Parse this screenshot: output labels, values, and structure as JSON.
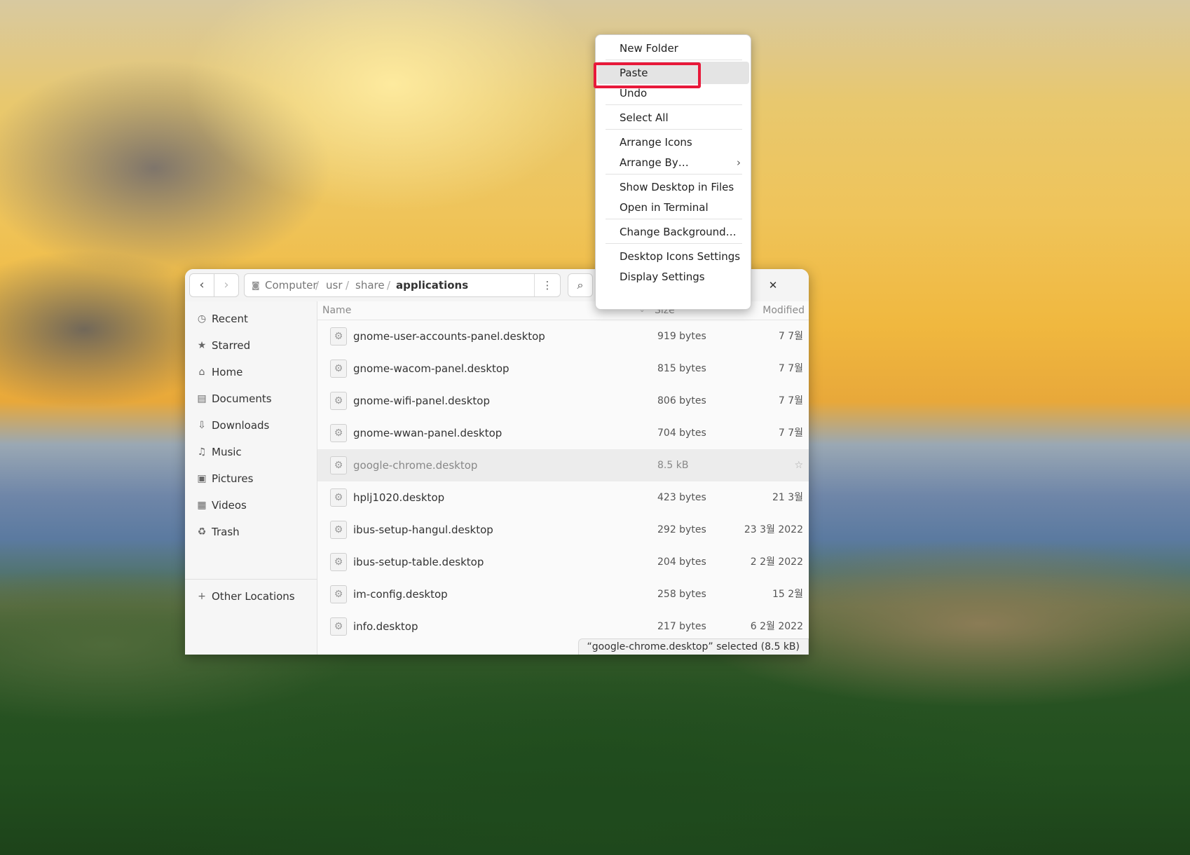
{
  "window": {
    "path": [
      "Computer",
      "usr",
      "share",
      "applications"
    ],
    "columns": {
      "name": "Name",
      "size": "Size",
      "modified": "Modified"
    },
    "sidebar": [
      {
        "label": "Recent",
        "icon": "clock-icon",
        "glyph": "◷"
      },
      {
        "label": "Starred",
        "icon": "star-icon",
        "glyph": "★"
      },
      {
        "label": "Home",
        "icon": "home-icon",
        "glyph": "⌂"
      },
      {
        "label": "Documents",
        "icon": "document-icon",
        "glyph": "▤"
      },
      {
        "label": "Downloads",
        "icon": "download-icon",
        "glyph": "⇩"
      },
      {
        "label": "Music",
        "icon": "music-icon",
        "glyph": "♫"
      },
      {
        "label": "Pictures",
        "icon": "picture-icon",
        "glyph": "▣"
      },
      {
        "label": "Videos",
        "icon": "video-icon",
        "glyph": "▦"
      },
      {
        "label": "Trash",
        "icon": "trash-icon",
        "glyph": "♻"
      }
    ],
    "other_locations": {
      "label": "Other Locations",
      "glyph": "+"
    },
    "files": [
      {
        "name": "gnome-user-accounts-panel.desktop",
        "size": "919 bytes",
        "modified": "7 7월"
      },
      {
        "name": "gnome-wacom-panel.desktop",
        "size": "815 bytes",
        "modified": "7 7월"
      },
      {
        "name": "gnome-wifi-panel.desktop",
        "size": "806 bytes",
        "modified": "7 7월"
      },
      {
        "name": "gnome-wwan-panel.desktop",
        "size": "704 bytes",
        "modified": "7 7월"
      },
      {
        "name": "google-chrome.desktop",
        "size": "8.5 kB",
        "modified": "",
        "selected": true
      },
      {
        "name": "hplj1020.desktop",
        "size": "423 bytes",
        "modified": "21 3월"
      },
      {
        "name": "ibus-setup-hangul.desktop",
        "size": "292 bytes",
        "modified": "23 3월 2022"
      },
      {
        "name": "ibus-setup-table.desktop",
        "size": "204 bytes",
        "modified": "2 2월 2022"
      },
      {
        "name": "im-config.desktop",
        "size": "258 bytes",
        "modified": "15 2월"
      },
      {
        "name": "info.desktop",
        "size": "217 bytes",
        "modified": "6 2월 2022"
      }
    ],
    "status": "“google-chrome.desktop” selected  (8.5 kB)"
  },
  "context_menu": {
    "items": [
      {
        "label": "New Folder"
      },
      {
        "label": "Paste",
        "highlighted": true
      },
      {
        "label": "Undo"
      },
      {
        "label": "Select All"
      },
      {
        "label": "Arrange Icons"
      },
      {
        "label": "Arrange By…",
        "submenu": true
      },
      {
        "label": "Show Desktop in Files"
      },
      {
        "label": "Open in Terminal"
      },
      {
        "label": "Change Background…"
      },
      {
        "label": "Desktop Icons Settings"
      },
      {
        "label": "Display Settings"
      }
    ]
  },
  "colors": {
    "highlight_box": "#e8193a"
  }
}
